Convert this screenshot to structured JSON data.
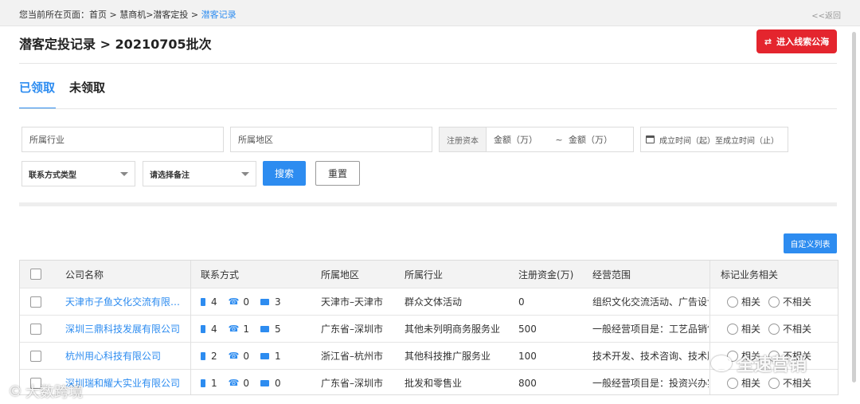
{
  "breadcrumb": {
    "prefix": "您当前所在页面：",
    "home": "首页",
    "sep": " > ",
    "section": "慧商机>潜客定投",
    "current": "潜客记录"
  },
  "back_label": "<<返回",
  "page_title": "潜客定投记录 > 20210705批次",
  "enter_pool_label": "进入线索公海",
  "tabs": [
    {
      "label": "已领取",
      "active": true
    },
    {
      "label": "未领取",
      "active": false
    }
  ],
  "filters": {
    "industry_placeholder": "所属行业",
    "region_placeholder": "所属地区",
    "capital_label": "注册资本",
    "capital_min_placeholder": "金额（万）",
    "capital_sep": "~",
    "capital_max_placeholder": "金额（万）",
    "date_range_placeholder": "成立时间（起）至成立时间（止）",
    "contact_type": "联系方式类型",
    "remark": "请选择备注",
    "search_label": "搜索",
    "reset_label": "重置"
  },
  "custom_columns_label": "自定义列表",
  "table": {
    "headers": {
      "name": "公司名称",
      "contact": "联系方式",
      "region": "所属地区",
      "industry": "所属行业",
      "capital": "注册资金(万)",
      "scope": "经营范围",
      "mark": "标记业务相关"
    },
    "radio_related": "相关",
    "radio_unrelated": "不相关",
    "rows": [
      {
        "name": "天津市子鱼文化交流有限公司",
        "mobile": "4",
        "phone": "0",
        "email": "3",
        "region": "天津市–天津市",
        "industry": "群众文体活动",
        "capital": "0",
        "scope": "组织文化交流活动、广告设计"
      },
      {
        "name": "深圳三鼎科技发展有限公司",
        "mobile": "4",
        "phone": "1",
        "email": "5",
        "region": "广东省–深圳市",
        "industry": "其他未列明商务服务业",
        "capital": "500",
        "scope": "一般经营项目是：工艺品销售"
      },
      {
        "name": "杭州用心科技有限公司",
        "mobile": "2",
        "phone": "0",
        "email": "1",
        "region": "浙江省–杭州市",
        "industry": "其他科技推广服务业",
        "capital": "100",
        "scope": "技术开发、技术咨询、技术服务"
      },
      {
        "name": "深圳瑞和耀大实业有限公司",
        "mobile": "1",
        "phone": "0",
        "email": "0",
        "region": "广东省–深圳市",
        "industry": "批发和零售业",
        "capital": "800",
        "scope": "一般经营项目是：投资兴办实业"
      }
    ]
  },
  "watermarks": {
    "left": "大数跨境",
    "right": "全速营销"
  },
  "colors": {
    "primary": "#2d8cf0",
    "danger": "#e4252e"
  }
}
